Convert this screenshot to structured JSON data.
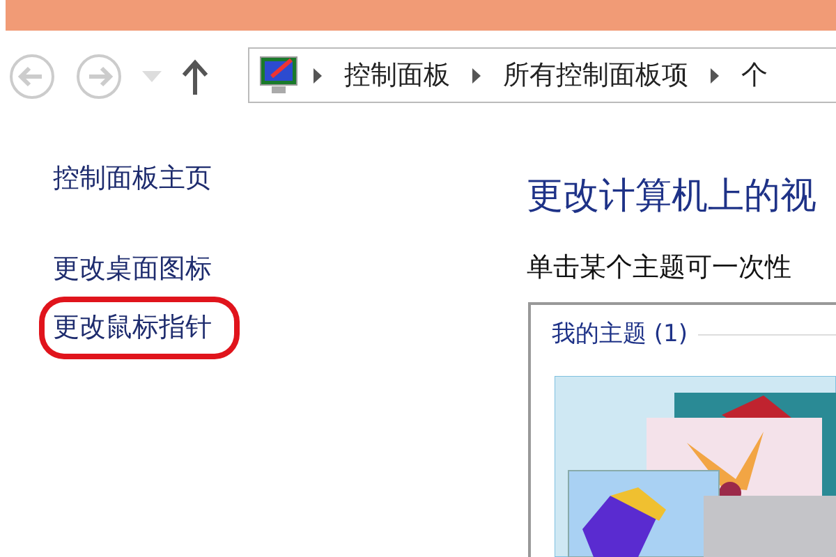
{
  "address_bar": {
    "crumbs": [
      "控制面板",
      "所有控制面板项",
      "个"
    ]
  },
  "sidebar": {
    "items": [
      {
        "label": "控制面板主页",
        "highlighted": false
      },
      {
        "label": "更改桌面图标",
        "highlighted": false
      },
      {
        "label": "更改鼠标指针",
        "highlighted": true
      }
    ]
  },
  "main": {
    "heading": "更改计算机上的视",
    "subtitle": "单击某个主题可一次性",
    "group": {
      "title": "我的主题 (1)"
    }
  }
}
